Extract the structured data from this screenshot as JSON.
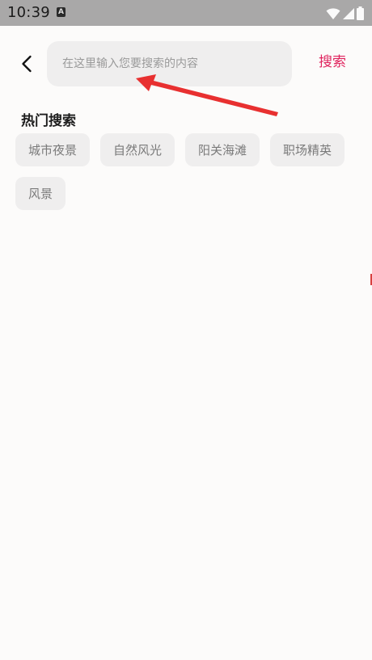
{
  "status_bar": {
    "time": "10:39",
    "notification_glyph": "A",
    "icons": [
      "wifi-icon",
      "cellular-signal-icon",
      "battery-icon"
    ]
  },
  "header": {
    "back_icon": "chevron-left-icon",
    "search_placeholder": "在这里输入您要搜索的内容",
    "search_value": "",
    "search_button_label": "搜索"
  },
  "hot_search": {
    "title": "热门搜索",
    "row1": [
      "城市夜景",
      "自然风光",
      "阳关海滩",
      "职场精英"
    ],
    "row2": [
      "风景"
    ]
  },
  "annotation": {
    "type": "red-arrow",
    "target": "search-input"
  },
  "colors": {
    "accent": "#e0245e",
    "status_bar_bg": "#a9a8a8",
    "chip_bg": "#efeeee",
    "arrow": "#e83030"
  }
}
